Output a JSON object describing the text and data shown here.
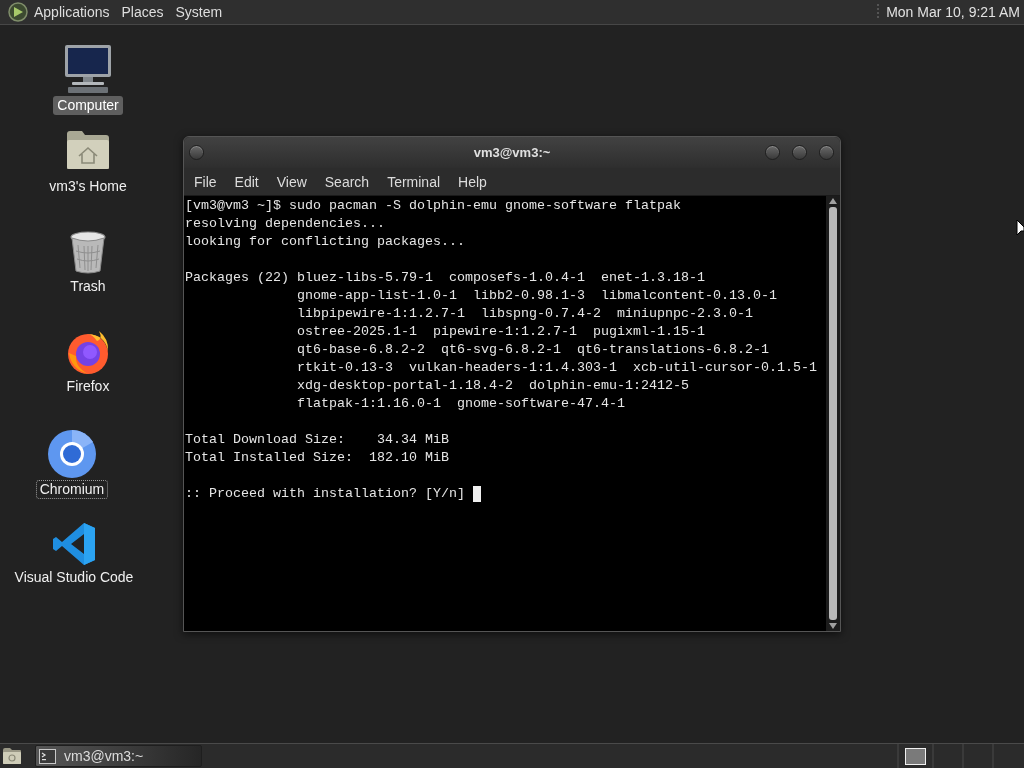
{
  "top_panel": {
    "menus": [
      "Applications",
      "Places",
      "System"
    ],
    "clock": "Mon Mar 10, 9:21 AM"
  },
  "desktop_icons": [
    {
      "label": "Computer",
      "kind": "computer",
      "selected": true,
      "focused": false
    },
    {
      "label": "vm3's Home",
      "kind": "home",
      "selected": false,
      "focused": false
    },
    {
      "label": "Trash",
      "kind": "trash",
      "selected": false,
      "focused": false
    },
    {
      "label": "Firefox",
      "kind": "firefox",
      "selected": false,
      "focused": false
    },
    {
      "label": "Chromium",
      "kind": "chromium",
      "selected": false,
      "focused": true
    },
    {
      "label": "Visual Studio Code",
      "kind": "vscode",
      "selected": false,
      "focused": false
    }
  ],
  "terminal_window": {
    "title": "vm3@vm3:~",
    "menus": [
      "File",
      "Edit",
      "View",
      "Search",
      "Terminal",
      "Help"
    ],
    "output": [
      {
        "kind": "lines",
        "lines": [
          "[vm3@vm3 ~]$ sudo pacman -S dolphin-emu gnome-software flatpak",
          "resolving dependencies...",
          "looking for conflicting packages..."
        ]
      },
      {
        "kind": "packages",
        "label": "Packages (22)",
        "rows": [
          "bluez-libs-5.79-1  composefs-1.0.4-1  enet-1.3.18-1",
          "gnome-app-list-1.0-1  libb2-0.98.1-3  libmalcontent-0.13.0-1",
          "libpipewire-1:1.2.7-1  libspng-0.7.4-2  miniupnpc-2.3.0-1",
          "ostree-2025.1-1  pipewire-1:1.2.7-1  pugixml-1.15-1",
          "qt6-base-6.8.2-2  qt6-svg-6.8.2-1  qt6-translations-6.8.2-1",
          "rtkit-0.13-3  vulkan-headers-1:1.4.303-1  xcb-util-cursor-0.1.5-1",
          "xdg-desktop-portal-1.18.4-2  dolphin-emu-1:2412-5",
          "flatpak-1:1.16.0-1  gnome-software-47.4-1"
        ]
      },
      {
        "kind": "lines",
        "lines": [
          "Total Download Size:    34.34 MiB",
          "Total Installed Size:  182.10 MiB"
        ]
      },
      {
        "kind": "prompt",
        "text": ":: Proceed with installation? [Y/n]",
        "cursor": true
      }
    ]
  },
  "taskbar": {
    "tasks": [
      {
        "label": "vm3@vm3:~",
        "selected": true
      }
    ],
    "workspaces": [
      {
        "selected": true
      }
    ]
  }
}
